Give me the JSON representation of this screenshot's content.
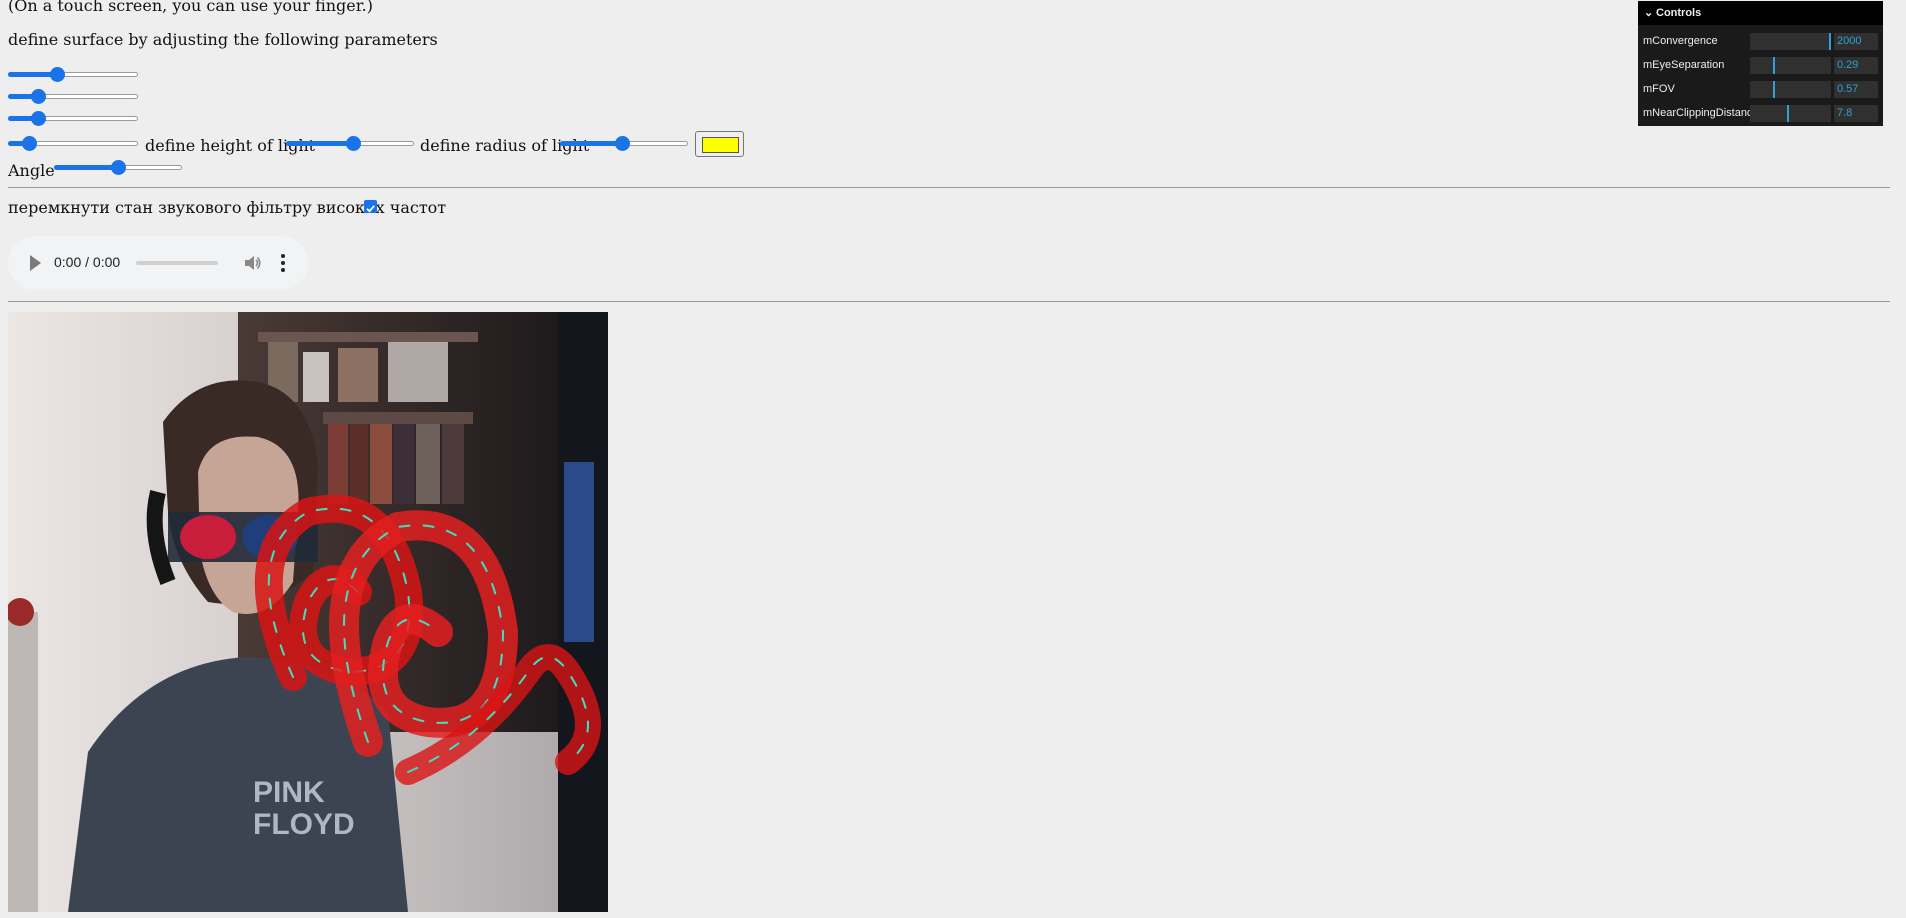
{
  "intro": {
    "touch_note": "(On a touch screen, you can use your finger.)",
    "surface_label": "define surface by adjusting the following parameters"
  },
  "surface_sliders": [
    {
      "name": "parameter-1",
      "value": 0.36
    },
    {
      "name": "parameter-2",
      "value": 0.2
    },
    {
      "name": "parameter-3",
      "value": 0.2
    },
    {
      "name": "parameter-4",
      "value": 0.12
    }
  ],
  "light": {
    "height_label": "define height of light",
    "height_value": 0.53,
    "radius_label": "define radius of light",
    "radius_value": 0.48,
    "color": "#ffff00"
  },
  "angle": {
    "label": "Angle",
    "value": 0.5
  },
  "filter": {
    "label": "перемкнути стан звукового фільтру високих частот",
    "checked": true
  },
  "audio": {
    "time": "0:00 / 0:00"
  },
  "controls_panel": {
    "title": "Controls",
    "rows": [
      {
        "label": "mConvergence",
        "value": "2000",
        "level": 1.0
      },
      {
        "label": "mEyeSeparation",
        "value": "0.29",
        "level": 0.29
      },
      {
        "label": "mFOV",
        "value": "0.57",
        "level": 0.28
      },
      {
        "label": "mNearClippingDistance",
        "value": "7.8",
        "level": 0.46
      }
    ]
  },
  "colors": {
    "accent": "#1a73e8",
    "panel_value": "#2fa1d6",
    "surface_red": "#e02020",
    "surface_edge": "#3fe0c0"
  }
}
